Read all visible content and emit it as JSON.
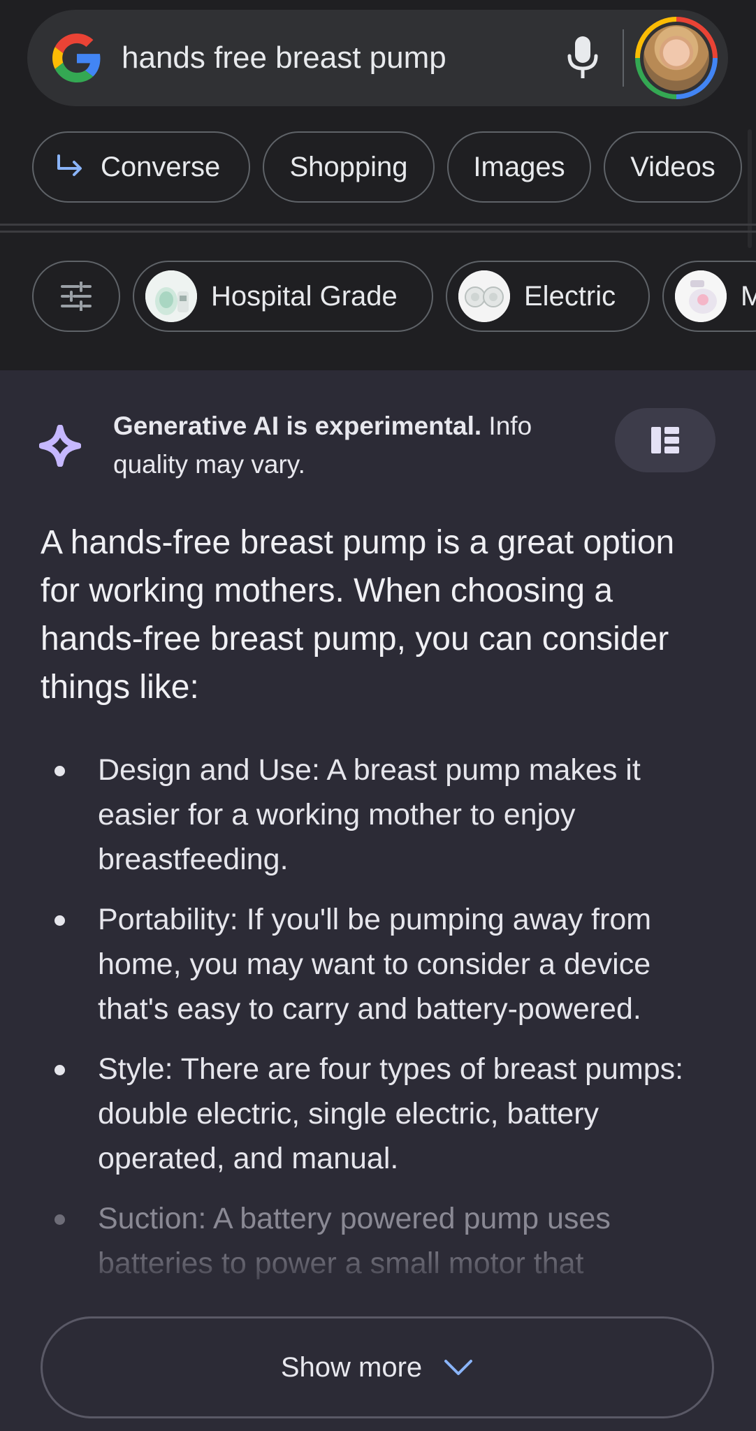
{
  "search": {
    "query": "hands free breast pump"
  },
  "tabs": [
    {
      "label": "Converse",
      "icon": "arrow-turn-right-icon"
    },
    {
      "label": "Shopping"
    },
    {
      "label": "Images"
    },
    {
      "label": "Videos"
    }
  ],
  "filters": [
    {
      "label": "Hospital Grade"
    },
    {
      "label": "Electric"
    },
    {
      "label": "M"
    }
  ],
  "ai": {
    "disclaimer_bold": "Generative AI is experimental.",
    "disclaimer_rest": " Info quality may vary.",
    "intro": "A hands-free breast pump is a great option for working mothers. When choosing a hands-free breast pump, you can consider things like:",
    "bullets": [
      "Design and Use: A breast pump makes it easier for a working mother to enjoy breastfeeding.",
      "Portability: If you'll be pumping away from home, you may want to consider a device that's easy to carry and battery-powered.",
      "Style: There are four types of breast pumps: double electric, single electric, battery operated, and manual.",
      "Suction: A battery powered pump uses batteries to power a small motor that"
    ],
    "show_more": "Show more"
  },
  "colors": {
    "header_bg": "#1f1f22",
    "search_bg": "#303134",
    "ai_bg": "#2c2b36",
    "sparkle": "#c6b8ff",
    "accent_blue": "#8ab4f8"
  }
}
